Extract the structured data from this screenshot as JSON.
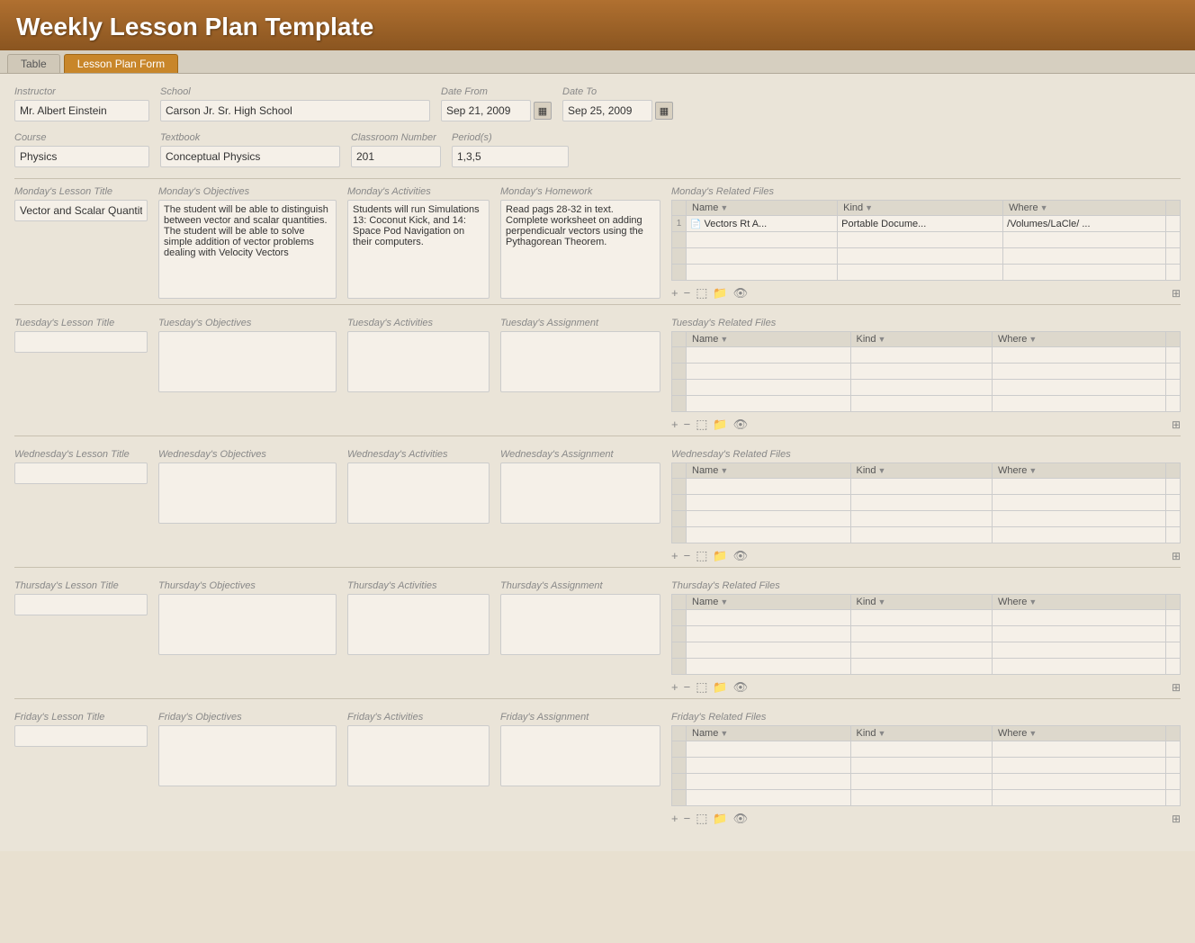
{
  "header": {
    "title": "Weekly Lesson Plan Template"
  },
  "tabs": [
    {
      "label": "Table",
      "active": false
    },
    {
      "label": "Lesson Plan Form",
      "active": true
    }
  ],
  "form": {
    "instructor_label": "Instructor",
    "instructor_value": "Mr. Albert Einstein",
    "school_label": "School",
    "school_value": "Carson Jr. Sr. High School",
    "date_from_label": "Date From",
    "date_from_value": "Sep 21, 2009",
    "date_to_label": "Date To",
    "date_to_value": "Sep 25, 2009",
    "course_label": "Course",
    "course_value": "Physics",
    "textbook_label": "Textbook",
    "textbook_value": "Conceptual Physics",
    "classroom_label": "Classroom Number",
    "classroom_value": "201",
    "periods_label": "Period(s)",
    "periods_value": "1,3,5"
  },
  "days": [
    {
      "id": "monday",
      "lesson_title_label": "Monday's Lesson Title",
      "lesson_title_value": "Vector and Scalar Quantities",
      "objectives_label": "Monday's Objectives",
      "objectives_value": "The student will be able to distinguish between vector and scalar quantities. The student will be able to solve simple addition of vector problems dealing with Velocity Vectors",
      "activities_label": "Monday's Activities",
      "activities_value": "Students will run Simulations 13: Coconut Kick, and 14: Space Pod Navigation on their computers.",
      "homework_label": "Monday's Homework",
      "homework_value": "Read pags 28-32 in text. Complete worksheet on adding perpendicualr vectors using the Pythagorean Theorem.",
      "files_label": "Monday's Related Files",
      "files": [
        {
          "num": "1",
          "name": "Vectors Rt A...",
          "kind": "Portable Docume...",
          "where": "/Volumes/LaCle/ ..."
        }
      ]
    },
    {
      "id": "tuesday",
      "lesson_title_label": "Tuesday's Lesson Title",
      "lesson_title_value": "",
      "objectives_label": "Tuesday's Objectives",
      "objectives_value": "",
      "activities_label": "Tuesday's Activities",
      "activities_value": "",
      "homework_label": "Tuesday's Assignment",
      "homework_value": "",
      "files_label": "Tuesday's Related Files",
      "files": []
    },
    {
      "id": "wednesday",
      "lesson_title_label": "Wednesday's Lesson Title",
      "lesson_title_value": "",
      "objectives_label": "Wednesday's Objectives",
      "objectives_value": "",
      "activities_label": "Wednesday's Activities",
      "activities_value": "",
      "homework_label": "Wednesday's Assignment",
      "homework_value": "",
      "files_label": "Wednesday's Related Files",
      "files": []
    },
    {
      "id": "thursday",
      "lesson_title_label": "Thursday's Lesson Title",
      "lesson_title_value": "",
      "objectives_label": "Thursday's Objectives",
      "objectives_value": "",
      "activities_label": "Thursday's Activities",
      "activities_value": "",
      "homework_label": "Thursday's Assignment",
      "homework_value": "",
      "files_label": "Thursday's Related Files",
      "files": []
    },
    {
      "id": "friday",
      "lesson_title_label": "Friday's Lesson Title",
      "lesson_title_value": "",
      "objectives_label": "Friday's Objectives",
      "objectives_value": "",
      "activities_label": "Friday's Activities",
      "activities_value": "",
      "homework_label": "Friday's Assignment",
      "homework_value": "",
      "files_label": "Friday's Related Files",
      "files": []
    }
  ],
  "table_headers": {
    "name": "Name",
    "kind": "Kind",
    "where": "Where"
  },
  "actions": {
    "add": "+",
    "remove": "−",
    "new_file": "📄",
    "folder": "📁",
    "eye": "👁"
  }
}
